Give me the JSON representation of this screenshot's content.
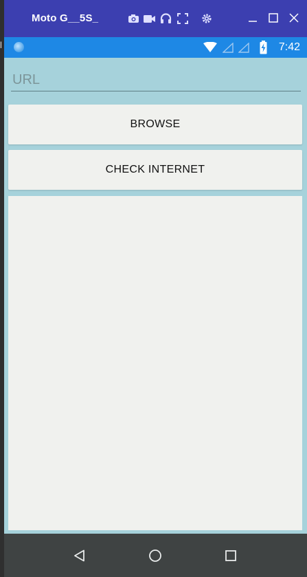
{
  "window": {
    "title": "Moto G__5S_",
    "toolbar_icons": [
      "camera-icon",
      "video-icon",
      "headset-icon",
      "fullscreen-icon",
      "settings-icon"
    ],
    "controls": [
      "minimize",
      "maximize",
      "close"
    ],
    "accent": "#3c3fb0"
  },
  "host": {
    "edge_text": "l"
  },
  "status_bar": {
    "time": "7:42",
    "icons": [
      "wifi-icon",
      "signal-icon",
      "signal-icon",
      "battery-charging-icon"
    ],
    "color": "#1e88e5"
  },
  "app": {
    "url_placeholder": "URL",
    "url_value": "",
    "browse_label": "BROWSE",
    "check_internet_label": "CHECK INTERNET",
    "background": "#a6d2db"
  },
  "nav_bar": {
    "buttons": [
      "back",
      "home",
      "recents"
    ]
  }
}
